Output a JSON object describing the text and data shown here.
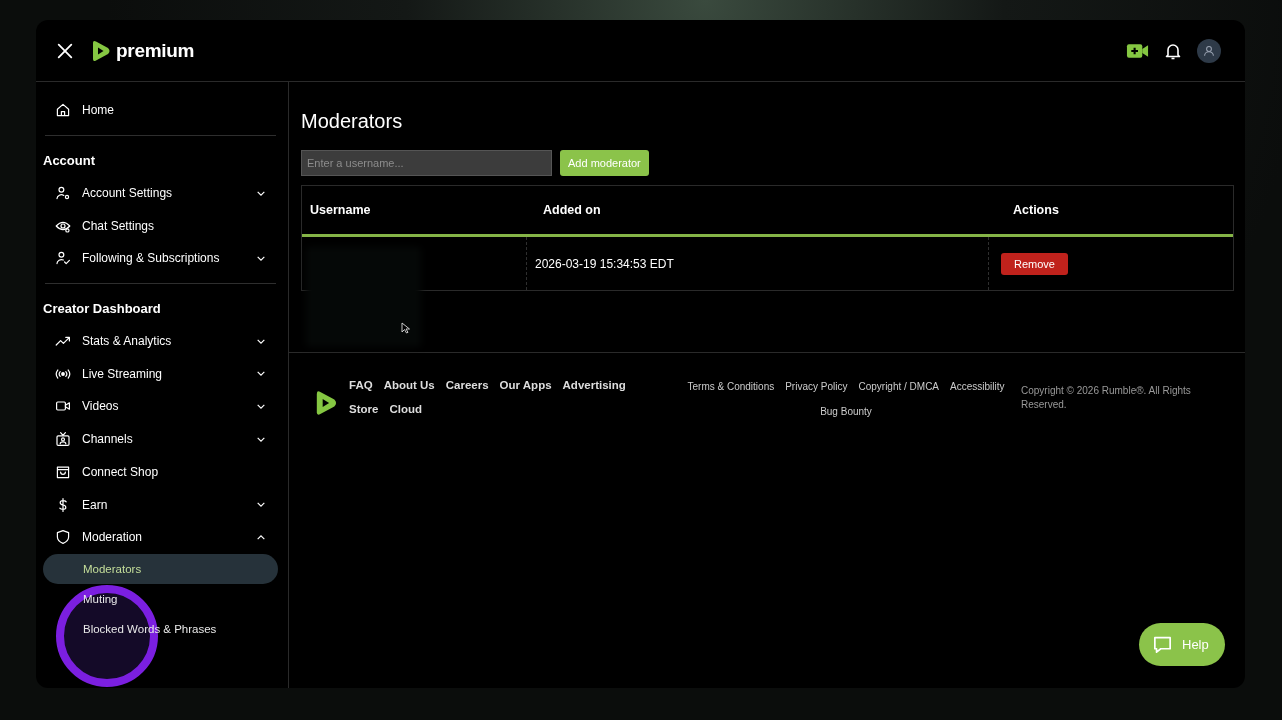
{
  "header": {
    "logo_text": "premium"
  },
  "sidebar": {
    "home": {
      "label": "Home",
      "selected": false
    },
    "sections": [
      {
        "title": "Account",
        "items": [
          {
            "label": "Account Settings",
            "kind": "group",
            "expanded": false
          },
          {
            "label": "Chat Settings",
            "kind": "link"
          },
          {
            "label": "Following & Subscriptions",
            "kind": "group",
            "expanded": false
          }
        ]
      },
      {
        "title": "Creator Dashboard",
        "items": [
          {
            "label": "Stats & Analytics",
            "kind": "group",
            "expanded": false
          },
          {
            "label": "Live Streaming",
            "kind": "group",
            "expanded": false
          },
          {
            "label": "Videos",
            "kind": "group",
            "expanded": false
          },
          {
            "label": "Channels",
            "kind": "group",
            "expanded": false
          },
          {
            "label": "Connect Shop",
            "kind": "link"
          },
          {
            "label": "Earn",
            "kind": "group",
            "expanded": false
          },
          {
            "label": "Moderation",
            "kind": "group",
            "expanded": true,
            "children": [
              {
                "label": "Moderators",
                "selected": true
              },
              {
                "label": "Muting",
                "selected": false
              },
              {
                "label": "Blocked Words & Phrases",
                "selected": false
              }
            ]
          }
        ]
      }
    ]
  },
  "page": {
    "title": "Moderators",
    "search": {
      "placeholder": "Enter a username..."
    },
    "add_button": "Add moderator",
    "table": {
      "columns": [
        "Username",
        "Added on",
        "Actions"
      ],
      "rows": [
        {
          "username_redacted": true,
          "added_on": "2026-03-19 15:34:53 EDT",
          "action": "Remove"
        }
      ]
    }
  },
  "footer": {
    "links_row_1": [
      "FAQ",
      "About Us",
      "Careers",
      "Our Apps",
      "Advertising"
    ],
    "links_row_2": [
      "Store",
      "Cloud"
    ],
    "legal_row_1": [
      "Terms & Conditions",
      "Privacy Policy",
      "Copyright / DMCA",
      "Accessibility"
    ],
    "legal_row_2": [
      "Bug Bounty"
    ],
    "copyright": "Copyright © 2026 Rumble®. All Rights Reserved."
  },
  "help_button": "Help"
}
